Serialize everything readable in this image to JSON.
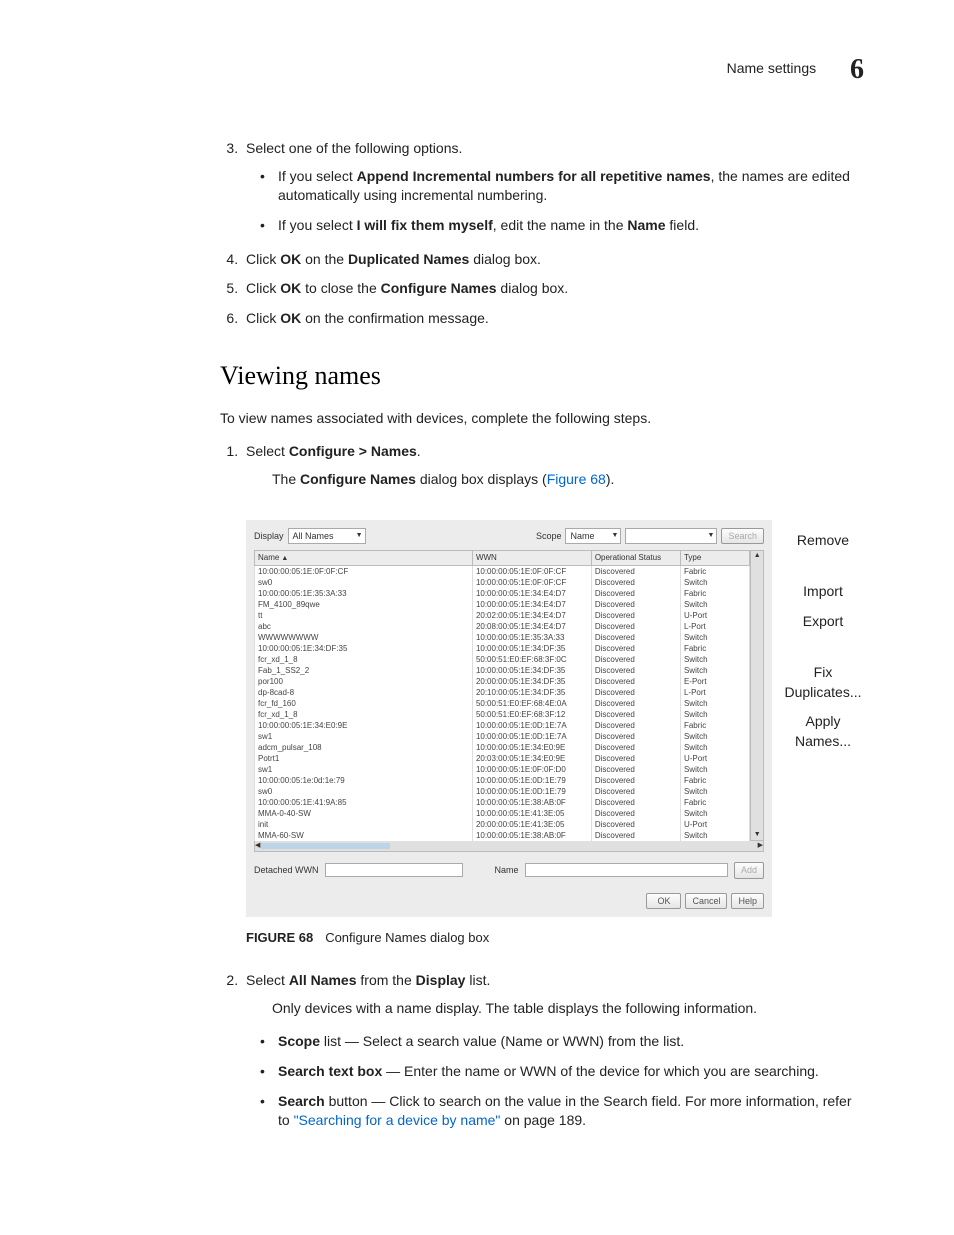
{
  "header": {
    "section": "Name settings",
    "chapter": "6"
  },
  "steps_a": {
    "s3": "Select one of the following options.",
    "s3_b1a": "If you select ",
    "s3_b1_bold": "Append Incremental numbers for all repetitive names",
    "s3_b1b": ", the names are edited automatically using incremental numbering.",
    "s3_b2a": "If you select ",
    "s3_b2_bold": "I will fix them myself",
    "s3_b2b": ", edit the name in the ",
    "s3_b2_bold2": "Name",
    "s3_b2c": " field.",
    "s4a": "Click ",
    "s4_bold1": "OK",
    "s4b": " on the ",
    "s4_bold2": "Duplicated Names",
    "s4c": " dialog box.",
    "s5a": "Click ",
    "s5_bold1": "OK",
    "s5b": " to close the ",
    "s5_bold2": "Configure Names",
    "s5c": " dialog box.",
    "s6a": "Click ",
    "s6_bold1": "OK",
    "s6b": " on the confirmation message."
  },
  "section_heading": "Viewing names",
  "intro": "To view names associated with devices, complete the following steps.",
  "steps_b": {
    "s1a": "Select ",
    "s1_bold": "Configure > Names",
    "s1b": ".",
    "s1_desc_a": "The ",
    "s1_desc_bold": "Configure Names",
    "s1_desc_b": " dialog box displays (",
    "s1_desc_link": "Figure 68",
    "s1_desc_c": ").",
    "s2a": "Select ",
    "s2_bold1": "All Names",
    "s2b": " from the ",
    "s2_bold2": "Display",
    "s2c": " list.",
    "s2_desc": "Only devices with a name display. The table displays the following information.",
    "b1_bold": "Scope",
    "b1_rest": " list — Select a search value (Name or WWN) from the list.",
    "b2_bold": "Search text box",
    "b2_rest": " — Enter the name or WWN of the device for which you are searching.",
    "b3_bold": "Search",
    "b3_rest_a": " button — Click to search on the value in the Search field. For more information, refer to ",
    "b3_link": "\"Searching for a device by name\"",
    "b3_rest_b": " on page 189."
  },
  "figure": {
    "num": "FIGURE 68",
    "caption": "Configure Names dialog box"
  },
  "dialog": {
    "display_label": "Display",
    "display_value": "All Names",
    "scope_label": "Scope",
    "scope_value": "Name",
    "search_btn": "Search",
    "headers": {
      "name": "Name",
      "wwn": "WWN",
      "status": "Operational Status",
      "type": "Type"
    },
    "side": {
      "remove": "Remove",
      "import": "Import",
      "export": "Export",
      "fix": "Fix Duplicates...",
      "apply": "Apply Names..."
    },
    "detached_label": "Detached WWN",
    "name_label": "Name",
    "add_btn": "Add",
    "ok": "OK",
    "cancel": "Cancel",
    "help": "Help",
    "rows": [
      {
        "n": "10:00:00:05:1E:0F:0F:CF",
        "w": "10:00:00:05:1E:0F:0F:CF",
        "s": "Discovered",
        "t": "Fabric"
      },
      {
        "n": "sw0",
        "w": "10:00:00:05:1E:0F:0F:CF",
        "s": "Discovered",
        "t": "Switch"
      },
      {
        "n": "10:00:00:05:1E:35:3A:33",
        "w": "10:00:00:05:1E:34:E4:D7",
        "s": "Discovered",
        "t": "Fabric"
      },
      {
        "n": "FM_4100_89qwe",
        "w": "10:00:00:05:1E:34:E4:D7",
        "s": "Discovered",
        "t": "Switch"
      },
      {
        "n": "tt",
        "w": "20:02:00:05:1E:34:E4:D7",
        "s": "Discovered",
        "t": "U-Port"
      },
      {
        "n": "abc",
        "w": "20:08:00:05:1E:34:E4:D7",
        "s": "Discovered",
        "t": "L-Port"
      },
      {
        "n": "WWWWWWWW",
        "w": "10:00:00:05:1E:35:3A:33",
        "s": "Discovered",
        "t": "Switch"
      },
      {
        "n": "10:00:00:05:1E:34:DF:35",
        "w": "10:00:00:05:1E:34:DF:35",
        "s": "Discovered",
        "t": "Fabric"
      },
      {
        "n": "fcr_xd_1_8",
        "w": "50:00:51:E0:EF:68:3F:0C",
        "s": "Discovered",
        "t": "Switch"
      },
      {
        "n": "Fab_1_SS2_2",
        "w": "10:00:00:05:1E:34:DF:35",
        "s": "Discovered",
        "t": "Switch"
      },
      {
        "n": "por100",
        "w": "20:00:00:05:1E:34:DF:35",
        "s": "Discovered",
        "t": "E-Port"
      },
      {
        "n": "dp-8cad-8",
        "w": "20:10:00:05:1E:34:DF:35",
        "s": "Discovered",
        "t": "L-Port"
      },
      {
        "n": "fcr_fd_160",
        "w": "50:00:51:E0:EF:68:4E:0A",
        "s": "Discovered",
        "t": "Switch"
      },
      {
        "n": "fcr_xd_1_8",
        "w": "50:00:51:E0:EF:68:3F:12",
        "s": "Discovered",
        "t": "Switch"
      },
      {
        "n": "10:00:00:05:1E:34:E0:9E",
        "w": "10:00:00:05:1E:0D:1E:7A",
        "s": "Discovered",
        "t": "Fabric"
      },
      {
        "n": "sw1",
        "w": "10:00:00:05:1E:0D:1E:7A",
        "s": "Discovered",
        "t": "Switch"
      },
      {
        "n": "adcm_pulsar_108",
        "w": "10:00:00:05:1E:34:E0:9E",
        "s": "Discovered",
        "t": "Switch"
      },
      {
        "n": "Potrt1",
        "w": "20:03:00:05:1E:34:E0:9E",
        "s": "Discovered",
        "t": "U-Port"
      },
      {
        "n": "sw1",
        "w": "10:00:00:05:1E:0F:0F:D0",
        "s": "Discovered",
        "t": "Switch"
      },
      {
        "n": "10:00:00:05:1e:0d:1e:79",
        "w": "10:00:00:05:1E:0D:1E:79",
        "s": "Discovered",
        "t": "Fabric"
      },
      {
        "n": "sw0",
        "w": "10:00:00:05:1E:0D:1E:79",
        "s": "Discovered",
        "t": "Switch"
      },
      {
        "n": "10:00:00:05:1E:41:9A:85",
        "w": "10:00:00:05:1E:38:AB:0F",
        "s": "Discovered",
        "t": "Fabric"
      },
      {
        "n": "MMA-0-40-SW",
        "w": "10:00:00:05:1E:41:3E:05",
        "s": "Discovered",
        "t": "Switch"
      },
      {
        "n": "init",
        "w": "20:00:00:05:1E:41:3E:05",
        "s": "Discovered",
        "t": "U-Port"
      },
      {
        "n": "MMA-60-SW",
        "w": "10:00:00:05:1E:38:AB:0F",
        "s": "Discovered",
        "t": "Switch"
      }
    ]
  }
}
